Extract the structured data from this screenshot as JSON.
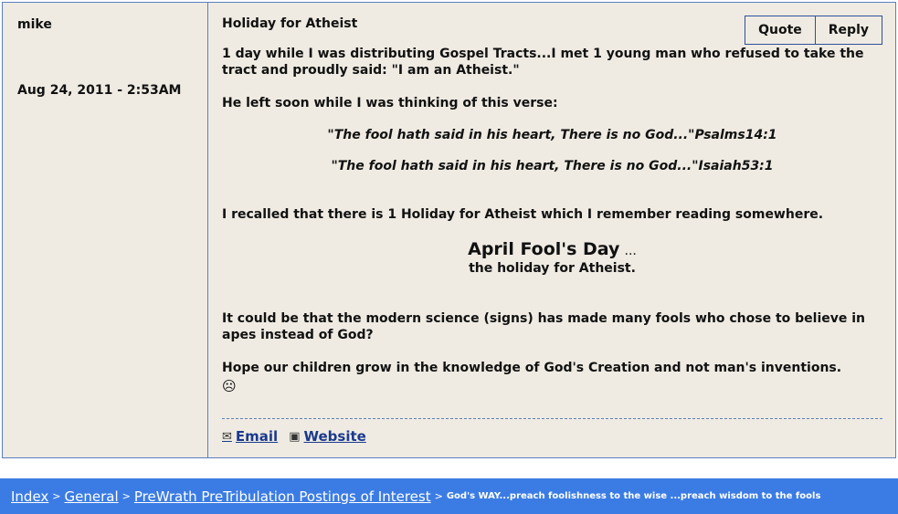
{
  "post": {
    "author": "mike",
    "date": "Aug 24, 2011 - 2:53AM",
    "title": "Holiday for Atheist",
    "actions": {
      "quote_label": "Quote",
      "reply_label": "Reply"
    },
    "paragraph1": "1 day while I was distributing Gospel Tracts...I met 1 young man who refused to take the tract and proudly said: \"I am an Atheist.\"",
    "paragraph2": "He left soon while I was thinking of this verse:",
    "verse1": "\"The fool hath said in his heart, There is no God...\"Psalms14:1",
    "verse2": "\"The fool hath said in his heart, There is no God...\"Isaiah53:1",
    "paragraph3": "I recalled that there is 1 Holiday for Atheist which I remember reading somewhere.",
    "feature_heading": "April Fool's Day",
    "feature_dots": "...",
    "feature_sub": "the holiday for Atheist.",
    "paragraph4": "It could be that the modern science (signs) has made many fools who chose to believe in apes instead of God?",
    "paragraph5": "Hope our children grow in the knowledge of God's Creation and not man's inventions.",
    "smiley": "☹",
    "links": {
      "email_label": "Email",
      "website_label": "Website"
    }
  },
  "breadcrumb": {
    "items": [
      "Index",
      "General",
      "PreWrath PreTribulation Postings of Interest"
    ],
    "separator": ">",
    "current": "God's WAY...preach foolishness to the wise ...preach wisdom to the fools"
  },
  "colors": {
    "accent": "#3b7ce4",
    "border": "#5a7fc0",
    "post_bg": "#efebe2",
    "link": "#1a3a8f"
  },
  "icons": {
    "email": "email-icon",
    "website": "website-icon",
    "smiley": "smiley-icon"
  }
}
